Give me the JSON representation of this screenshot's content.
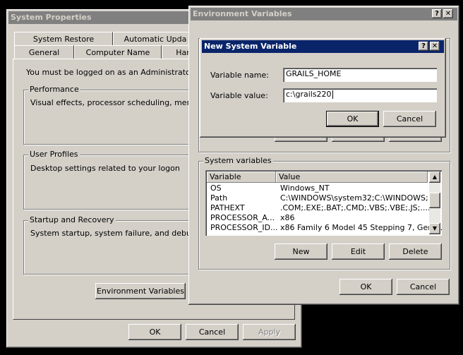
{
  "system_properties": {
    "title": "System Properties",
    "tabs_row1": [
      "System Restore",
      "Automatic Upda"
    ],
    "tabs_row2": [
      "General",
      "Computer Name",
      "Har"
    ],
    "admin_notice": "You must be logged on as an Administrator to ma",
    "performance": {
      "label": "Performance",
      "description": "Visual effects, processor scheduling, memory us"
    },
    "user_profiles": {
      "label": "User Profiles",
      "description": "Desktop settings related to your logon"
    },
    "startup_recovery": {
      "label": "Startup and Recovery",
      "description": "System startup, system failure, and debugging ir"
    },
    "env_button": "Environment Variables",
    "ok": "OK",
    "cancel": "Cancel",
    "apply": "Apply"
  },
  "environment_variables": {
    "title": "Environment Variables",
    "help_icon": "?",
    "close_icon": "✕",
    "system_vars_label": "System variables",
    "columns": [
      "Variable",
      "Value"
    ],
    "rows": [
      {
        "variable": "OS",
        "value": "Windows_NT"
      },
      {
        "variable": "Path",
        "value": "C:\\WINDOWS\\system32;C:\\WINDOWS;..."
      },
      {
        "variable": "PATHEXT",
        "value": ".COM;.EXE;.BAT;.CMD;.VBS;.VBE;.JS;...."
      },
      {
        "variable": "PROCESSOR_A...",
        "value": "x86"
      },
      {
        "variable": "PROCESSOR_ID...",
        "value": "x86 Family 6 Model 45 Stepping 7, Genu..."
      }
    ],
    "new": "New",
    "edit": "Edit",
    "delete": "Delete",
    "ok": "OK",
    "cancel": "Cancel"
  },
  "new_system_variable": {
    "title": "New System Variable",
    "help_icon": "?",
    "close_icon": "✕",
    "name_label": "Variable name:",
    "name_value": "GRAILS_HOME",
    "value_label": "Variable value:",
    "value_value": "c:\\grails220",
    "ok": "OK",
    "cancel": "Cancel"
  },
  "colors": {
    "active_title": "#0a246a",
    "inactive_title": "#808080",
    "face": "#d4d0c8"
  }
}
